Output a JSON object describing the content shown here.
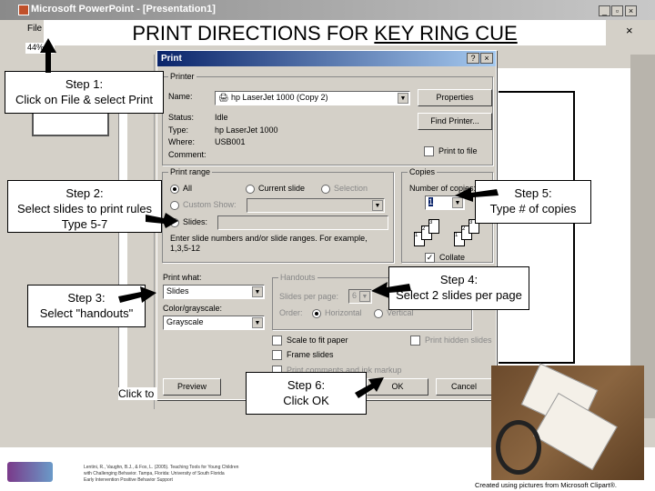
{
  "window": {
    "title": "Microsoft PowerPoint - [Presentation1]",
    "menu_file": "File",
    "zoom": "44%",
    "controls": [
      "_",
      "▫",
      "×"
    ]
  },
  "slide_title": {
    "prefix": "PRINT DIRECTIONS FOR ",
    "underlined": "KEY RING CUE"
  },
  "dialog": {
    "title": "Print",
    "help": "?",
    "close": "×",
    "printer": {
      "group": "Printer",
      "name_label": "Name:",
      "name_value": "hp LaserJet 1000 (Copy 2)",
      "status_label": "Status:",
      "status": "Idle",
      "type_label": "Type:",
      "type": "hp LaserJet 1000",
      "where_label": "Where:",
      "where": "USB001",
      "comment_label": "Comment:",
      "properties": "Properties",
      "find_printer": "Find Printer...",
      "print_to_file": "Print to file"
    },
    "range": {
      "group": "Print range",
      "all": "All",
      "current": "Current slide",
      "selection": "Selection",
      "custom": "Custom Show:",
      "slides": "Slides:",
      "hint": "Enter slide numbers and/or slide ranges. For example, 1,3,5-12"
    },
    "copies": {
      "group": "Copies",
      "label": "Number of copies:",
      "value": "1",
      "collate": "Collate"
    },
    "print_what": {
      "label": "Print what:",
      "value": "Slides",
      "color_label": "Color/grayscale:",
      "color_value": "Grayscale"
    },
    "handouts": {
      "group": "Handouts",
      "per_page_label": "Slides per page:",
      "per_page": "6",
      "order_label": "Order:",
      "horizontal": "Horizontal",
      "vertical": "Vertical"
    },
    "options": {
      "scale": "Scale to fit paper",
      "frame": "Frame slides",
      "comments": "Print comments and ink markup",
      "hidden": "Print hidden slides"
    },
    "buttons": {
      "preview": "Preview",
      "ok": "OK",
      "cancel": "Cancel"
    }
  },
  "callouts": {
    "step1": {
      "title": "Step 1:",
      "text": "Click on File &  select Print"
    },
    "step2": {
      "title": "Step 2:",
      "text": "Select slides to print rules",
      "text2": "Type 5-7"
    },
    "step3": {
      "title": "Step 3:",
      "text": "Select \"handouts\""
    },
    "step4": {
      "title": "Step 4:",
      "text": "Select 2 slides per page"
    },
    "step5": {
      "title": "Step 5:",
      "text": "Type # of copies"
    },
    "step6": {
      "title": "Step 6:",
      "text": "Click OK"
    }
  },
  "notes_text": "Click to",
  "footer": {
    "citation": [
      "Lentini, R., Vaughn, B.J., & Fox, L. (2005). Teaching Tools for Young Children",
      "with Challenging Behavior. Tampa, Florida: University of South Florida",
      "Early Intervention Positive Behavior Support"
    ],
    "credit": "Created using pictures from Microsoft Clipart®."
  }
}
